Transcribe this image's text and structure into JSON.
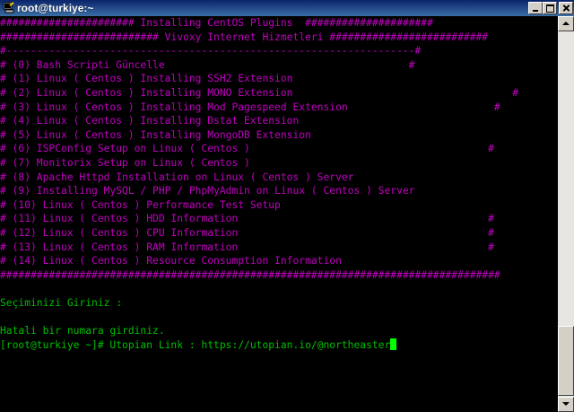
{
  "window": {
    "title": "root@turkiye:~"
  },
  "terminal": {
    "lines": [
      {
        "text": "###################### Installing CentOS Plugins  #####################",
        "color": "magenta"
      },
      {
        "text": "########################## Vivoxy Internet Hizmetleri ##########################",
        "color": "magenta"
      },
      {
        "text": "#-------------------------------------------------------------------#",
        "color": "magenta"
      },
      {
        "text": "# (0) Bash Scripti Güncelle                                        #",
        "color": "magenta"
      },
      {
        "text": "# (1) Linux ( Centos ) Installing SSH2 Extension",
        "color": "magenta"
      },
      {
        "text": "# (2) Linux ( Centos ) Installing MONO Extension                                    #",
        "color": "magenta"
      },
      {
        "text": "# (3) Linux ( Centos ) Installing Mod Pagespeed Extension                        #",
        "color": "magenta"
      },
      {
        "text": "# (4) Linux ( Centos ) Installing Dstat Extension",
        "color": "magenta"
      },
      {
        "text": "# (5) Linux ( Centos ) Installing MongoDB Extension",
        "color": "magenta"
      },
      {
        "text": "# (6) ISPConfig Setup on Linux ( Centos )                                       #",
        "color": "magenta"
      },
      {
        "text": "# (7) Monitorix Setup on Linux ( Centos )",
        "color": "magenta"
      },
      {
        "text": "# (8) Apache Httpd Installation on Linux ( Centos ) Server",
        "color": "magenta"
      },
      {
        "text": "# (9) Installing MySQL / PHP / PhpMyAdmin on Linux ( Centos ) Server",
        "color": "magenta"
      },
      {
        "text": "# (10) Linux ( Centos ) Performance Test Setup",
        "color": "magenta"
      },
      {
        "text": "# (11) Linux ( Centos ) HDD Information                                         #",
        "color": "magenta"
      },
      {
        "text": "# (12) Linux ( Centos ) CPU Information                                         #",
        "color": "magenta"
      },
      {
        "text": "# (13) Linux ( Centos ) RAM Information                                         #",
        "color": "magenta"
      },
      {
        "text": "# (14) Linux ( Centos ) Resource Consumption Information",
        "color": "magenta"
      },
      {
        "text": "##################################################################################",
        "color": "magenta"
      },
      {
        "text": "",
        "color": "grey"
      },
      {
        "text": "Seçiminizi Giriniz :",
        "color": "green"
      },
      {
        "text": "",
        "color": "grey"
      },
      {
        "text": "Hatali bir numara girdiniz.",
        "color": "green"
      }
    ],
    "prompt": {
      "text": "[root@turkiye ~]# Utopian Link : https://utopian.io/@northeaster",
      "color": "green"
    }
  }
}
